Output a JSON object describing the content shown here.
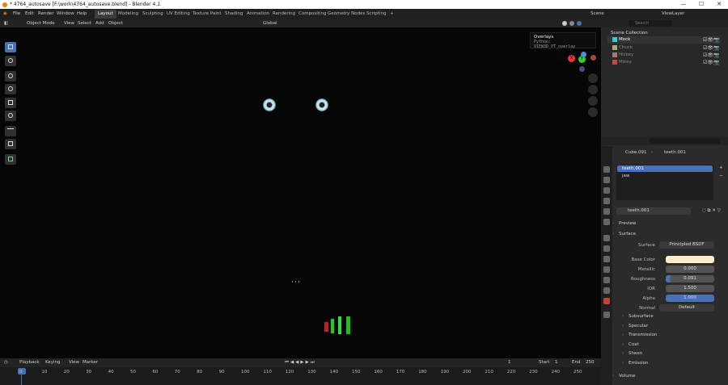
{
  "window": {
    "title": "* 4764_autosave [F:\\work\\4764_autosave.blend] - Blender 4.1",
    "min": "—",
    "max": "☐",
    "close": "✕"
  },
  "menus": [
    "File",
    "Edit",
    "Render",
    "Window",
    "Help"
  ],
  "workspaces": [
    "Layout",
    "Modeling",
    "Sculpting",
    "UV Editing",
    "Texture Paint",
    "Shading",
    "Animation",
    "Rendering",
    "Compositing",
    "Geometry Nodes",
    "Scripting",
    "+"
  ],
  "scene": {
    "label": "Scene",
    "viewlayer": "ViewLayer"
  },
  "viewport": {
    "mode": "Object Mode",
    "menus": [
      "View",
      "Select",
      "Add",
      "Object"
    ],
    "transform": "Global"
  },
  "tooltip": {
    "title": "Overlays",
    "python": "Python: VIEW3D_PT_overlay"
  },
  "gizmo": {
    "x": "X",
    "y": "Y",
    "z": "Z"
  },
  "outliner": {
    "search_placeholder": "Search",
    "root": "Scene Collection",
    "items": [
      "Mock",
      "Chuck",
      "Hickey",
      "Mikey"
    ]
  },
  "props": {
    "breadcrumb_object": "Cube.091",
    "breadcrumb_material": "teeth.001",
    "slots": [
      "teeth.001",
      "jaw"
    ],
    "material": "teeth.001",
    "preview": "Preview",
    "surface": "Surface",
    "surface_label": "Surface",
    "surface_value": "Principled BSDF",
    "fields": [
      {
        "label": "Base Color",
        "value": ""
      },
      {
        "label": "Metallic",
        "value": "0.000"
      },
      {
        "label": "Roughness",
        "value": "0.091"
      },
      {
        "label": "IOR",
        "value": "1.500"
      },
      {
        "label": "Alpha",
        "value": "1.000"
      },
      {
        "label": "Normal",
        "value": "Default"
      }
    ],
    "sections": [
      "Subsurface",
      "Specular",
      "Transmission",
      "Coat",
      "Sheen",
      "Emission",
      "Volume"
    ]
  },
  "timeline": {
    "menus": [
      "Playback",
      "Keying",
      "View",
      "Marker"
    ],
    "current": "1",
    "start_label": "Start",
    "start": "1",
    "end_label": "End",
    "end": "250",
    "ticks": [
      "0",
      "10",
      "20",
      "30",
      "40",
      "50",
      "60",
      "70",
      "80",
      "90",
      "100",
      "110",
      "120",
      "130",
      "140",
      "150",
      "160",
      "170",
      "180",
      "190",
      "200",
      "210",
      "220",
      "230",
      "240",
      "250"
    ]
  },
  "colors": {
    "accent": "#4772b3",
    "base_color": "#ffecc8",
    "viewport_bg": "#060606"
  }
}
